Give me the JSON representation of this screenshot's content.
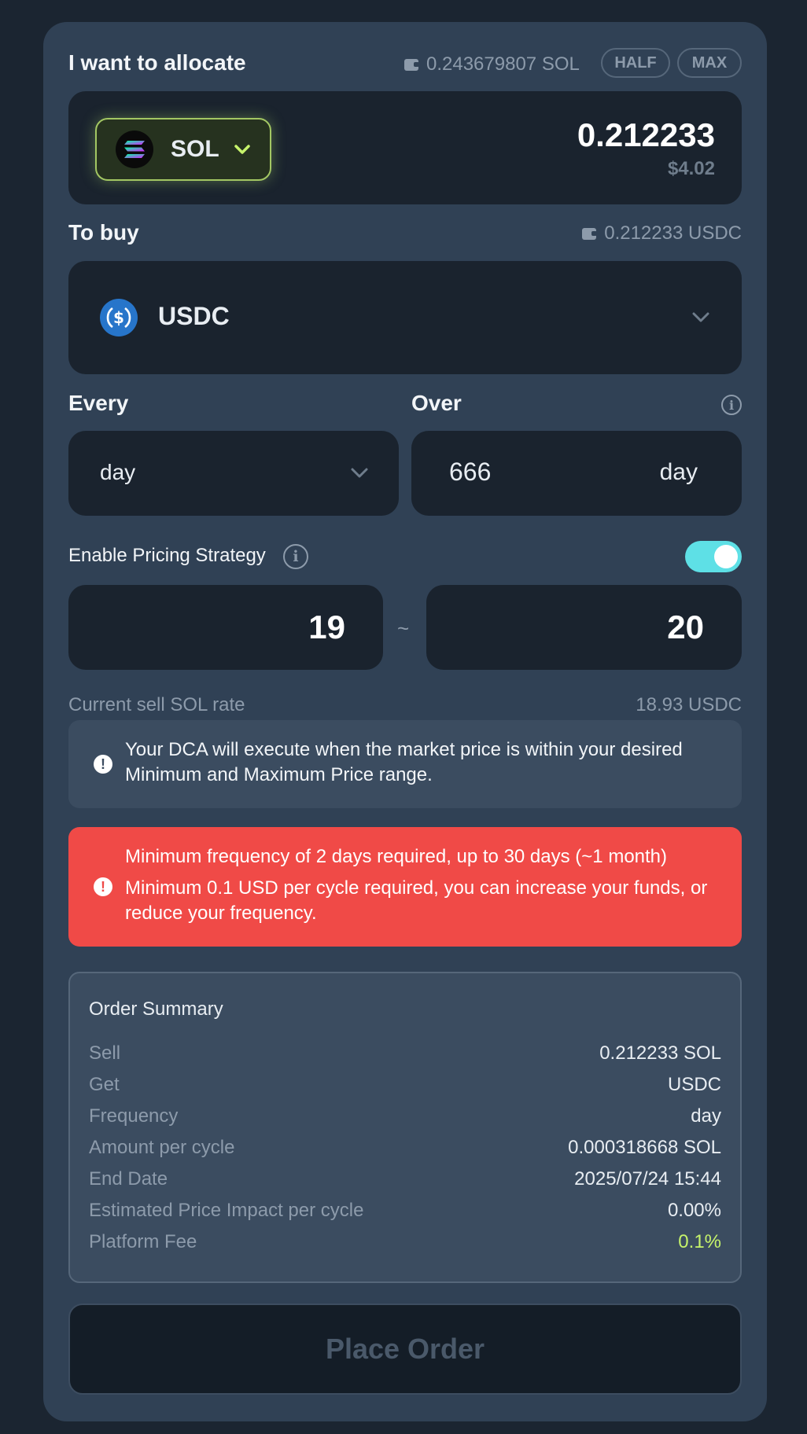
{
  "allocate": {
    "label": "I want to allocate",
    "balance": "0.243679807 SOL",
    "half_label": "HALF",
    "max_label": "MAX",
    "token": "SOL",
    "amount": "0.212233",
    "usd_value": "$4.02"
  },
  "buy": {
    "label": "To buy",
    "balance": "0.212233 USDC",
    "token": "USDC"
  },
  "every": {
    "label": "Every",
    "value": "day"
  },
  "over": {
    "label": "Over",
    "count": "666",
    "unit": "day"
  },
  "pricing": {
    "label": "Enable Pricing Strategy",
    "enabled": true,
    "min": "19",
    "max": "20",
    "separator": "~",
    "rate_label": "Current sell SOL rate",
    "rate_value": "18.93 USDC"
  },
  "info_notice": "Your DCA will execute when the market price is within your desired Minimum and Maximum Price range.",
  "errors": {
    "line1": "Minimum frequency of 2 days required, up to 30 days (~1 month)",
    "line2": "Minimum 0.1 USD per cycle required, you can increase your funds, or reduce your frequency."
  },
  "summary": {
    "title": "Order Summary",
    "rows": [
      {
        "key": "Sell",
        "value": "0.212233 SOL"
      },
      {
        "key": "Get",
        "value": "USDC"
      },
      {
        "key": "Frequency",
        "value": "day"
      },
      {
        "key": "Amount per cycle",
        "value": "0.000318668 SOL"
      },
      {
        "key": "End Date",
        "value": "2025/07/24 15:44"
      },
      {
        "key": "Estimated Price Impact per cycle",
        "value": "0.00%"
      },
      {
        "key": "Platform Fee",
        "value": "0.1%"
      }
    ]
  },
  "place_order_label": "Place Order",
  "colors": {
    "accent_green": "#c6f36b",
    "toggle": "#5ee0e6",
    "error": "#f04a47",
    "usdc_blue": "#2775ca"
  }
}
